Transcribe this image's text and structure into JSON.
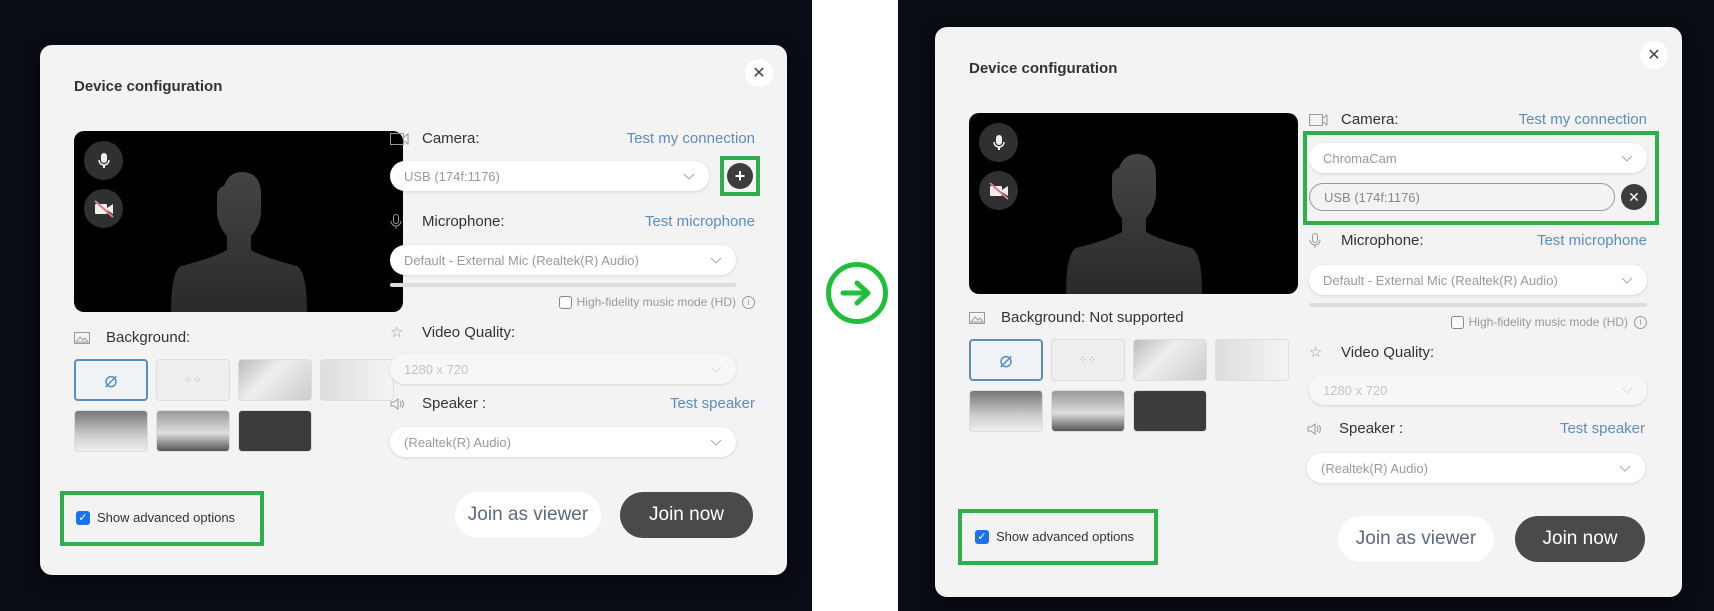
{
  "colors": {
    "backdrop": "#0b0d16",
    "dialog_bg": "#f3f3f3",
    "link": "#5a8dc0",
    "highlight": "#2fae4e",
    "arrow": "#1fbf3c",
    "join_button": "#4a4a4a",
    "checkbox_checked": "#1a73e8",
    "cam_off_slash": "#e07a7a"
  },
  "arrow_icon": "arrow-right-circle",
  "before": {
    "title": "Device configuration",
    "close_icon": "close-icon",
    "camera": {
      "label": "Camera:",
      "test_link": "Test my connection",
      "selected": "USB (174f:1176)",
      "add_icon": "plus-circle-icon"
    },
    "microphone": {
      "label": "Microphone:",
      "test_link": "Test microphone",
      "selected": "Default - External Mic (Realtek(R) Audio)",
      "hifi_label": "High-fidelity music mode (HD)",
      "hifi_checked": false
    },
    "video_quality": {
      "label": "Video Quality:",
      "selected": "1280 x 720"
    },
    "speaker": {
      "label": "Speaker :",
      "test_link": "Test speaker",
      "selected": "(Realtek(R) Audio)"
    },
    "background": {
      "label": "Background:",
      "tiles": [
        "none",
        "blur",
        "room",
        "office",
        "beach",
        "window-beach",
        "dark-texture"
      ],
      "selected": "none"
    },
    "advanced": {
      "label": "Show advanced options",
      "checked": true
    },
    "buttons": {
      "viewer": "Join as viewer",
      "join": "Join now"
    },
    "preview": {
      "mic_on": true,
      "camera_off": true
    }
  },
  "after": {
    "title": "Device configuration",
    "close_icon": "close-icon",
    "camera": {
      "label": "Camera:",
      "test_link": "Test my connection",
      "selected": "ChromaCam",
      "secondary": "USB (174f:1176)",
      "remove_icon": "x-circle-icon"
    },
    "microphone": {
      "label": "Microphone:",
      "test_link": "Test microphone",
      "selected": "Default - External Mic (Realtek(R) Audio)",
      "hifi_label": "High-fidelity music mode (HD)",
      "hifi_checked": false
    },
    "video_quality": {
      "label": "Video Quality:",
      "selected": "1280 x 720"
    },
    "speaker": {
      "label": "Speaker :",
      "test_link": "Test speaker",
      "selected": "(Realtek(R) Audio)"
    },
    "background": {
      "label": "Background: Not supported",
      "tiles": [
        "none",
        "blur",
        "room",
        "office",
        "beach",
        "window-beach",
        "dark-texture"
      ],
      "selected": "none"
    },
    "advanced": {
      "label": "Show advanced options",
      "checked": true
    },
    "buttons": {
      "viewer": "Join as viewer",
      "join": "Join now"
    },
    "preview": {
      "mic_on": true,
      "camera_off": true
    }
  }
}
